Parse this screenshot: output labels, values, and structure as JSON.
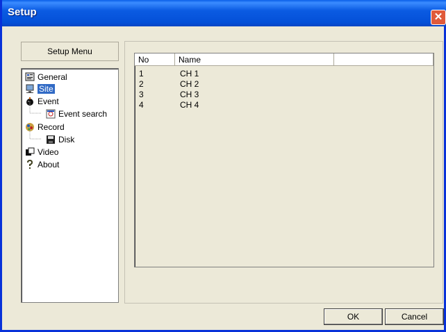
{
  "window": {
    "title": "Setup",
    "close_glyph": "✕"
  },
  "setup_menu": {
    "label": "Setup Menu",
    "items": [
      {
        "label": "General",
        "icon": "general-icon",
        "level": 0
      },
      {
        "label": "Site",
        "icon": "site-icon",
        "level": 0,
        "selected": true
      },
      {
        "label": "Event",
        "icon": "event-icon",
        "level": 0
      },
      {
        "label": "Event search",
        "icon": "event-search-icon",
        "level": 1
      },
      {
        "label": "Record",
        "icon": "record-icon",
        "level": 0
      },
      {
        "label": "Disk",
        "icon": "disk-icon",
        "level": 1
      },
      {
        "label": "Video",
        "icon": "video-icon",
        "level": 0
      },
      {
        "label": "About",
        "icon": "about-icon",
        "level": 0
      }
    ]
  },
  "site_table": {
    "columns": [
      "No",
      "Name",
      ""
    ],
    "rows": [
      {
        "no": "1",
        "name": "CH 1"
      },
      {
        "no": "2",
        "name": "CH 2"
      },
      {
        "no": "3",
        "name": "CH 3"
      },
      {
        "no": "4",
        "name": "CH 4"
      }
    ]
  },
  "buttons": {
    "ok": "OK",
    "cancel": "Cancel"
  },
  "colors": {
    "titlebar": "#0a5fe8",
    "selection": "#316ac5",
    "dialog_bg": "#ece9d8"
  }
}
